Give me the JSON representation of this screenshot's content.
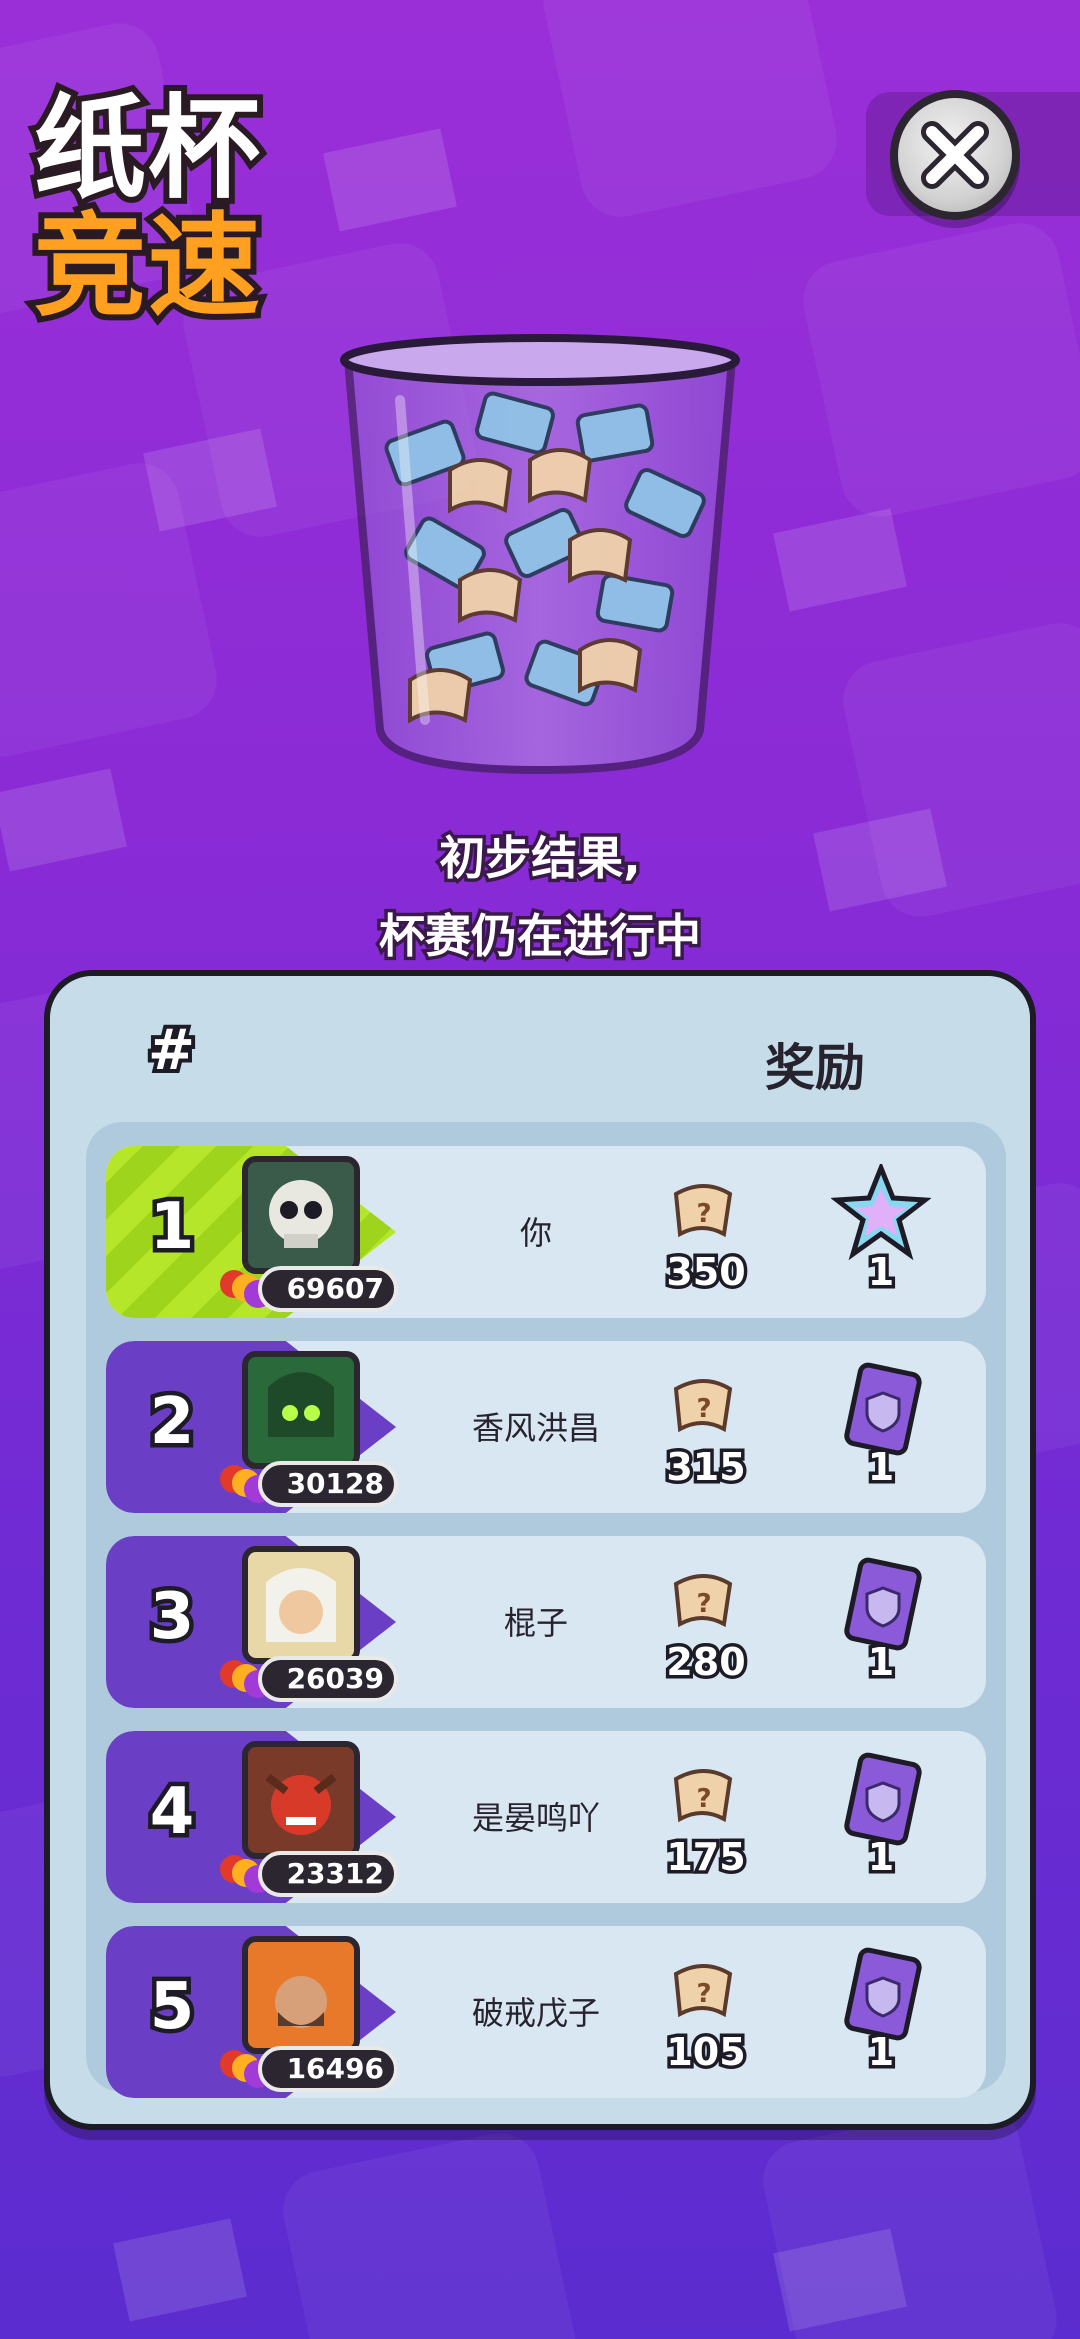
{
  "title": {
    "line1": "纸杯",
    "line2": "竞速"
  },
  "close_button": {
    "icon": "close-icon"
  },
  "status": {
    "line1": "初步结果,",
    "line2": "杯赛仍在进行中"
  },
  "table": {
    "header_rank": "#",
    "header_reward": "奖励",
    "rows": [
      {
        "rank": "1",
        "name": "你",
        "trophies": "69607",
        "score": "350",
        "reward_count": "1",
        "reward_icon": "star-crystal-icon",
        "avatar_icon": "skull-avatar-icon",
        "highlight": true
      },
      {
        "rank": "2",
        "name": "香风洪昌",
        "trophies": "30128",
        "score": "315",
        "reward_count": "1",
        "reward_icon": "shield-pack-icon",
        "avatar_icon": "green-knight-avatar-icon",
        "highlight": false
      },
      {
        "rank": "3",
        "name": "棍子",
        "trophies": "26039",
        "score": "280",
        "reward_count": "1",
        "reward_icon": "shield-pack-icon",
        "avatar_icon": "elf-avatar-icon",
        "highlight": false
      },
      {
        "rank": "4",
        "name": "是晏鸣吖",
        "trophies": "23312",
        "score": "175",
        "reward_count": "1",
        "reward_icon": "shield-pack-icon",
        "avatar_icon": "red-demon-avatar-icon",
        "highlight": false
      },
      {
        "rank": "5",
        "name": "破戒戊子",
        "trophies": "16496",
        "score": "105",
        "reward_count": "1",
        "reward_icon": "shield-pack-icon",
        "avatar_icon": "pumpkin-avatar-icon",
        "highlight": false
      }
    ]
  },
  "colors": {
    "accent_green": "#b6e62a",
    "rank_purple": "#6a3fc6",
    "title_orange": "#ffa020"
  }
}
